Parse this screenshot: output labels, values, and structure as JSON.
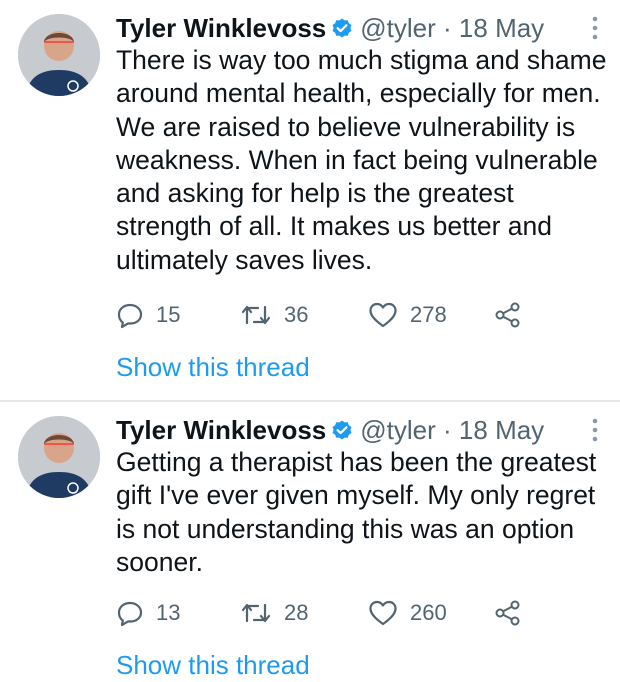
{
  "tweets": [
    {
      "author_name": "Tyler Winklevoss",
      "handle": "@tyler",
      "separator": "·",
      "date": "18 May",
      "text": "There is way too much stigma and shame around mental health, especially for men. We are raised to believe vulnerability is weakness. When in fact being vulnerable and asking for help is the greatest strength of all. It makes us better and ultimately saves lives.",
      "replies": "15",
      "retweets": "36",
      "likes": "278",
      "show_thread": "Show this thread"
    },
    {
      "author_name": "Tyler Winklevoss",
      "handle": "@tyler",
      "separator": "·",
      "date": "18 May",
      "text": "Getting a therapist has been the greatest gift I've ever given myself. My only regret is not understanding this was an option sooner.",
      "replies": "13",
      "retweets": "28",
      "likes": "260",
      "show_thread": "Show this thread"
    }
  ],
  "colors": {
    "link": "#1d9bf0",
    "muted": "#536471",
    "verified": "#1d9bf0",
    "divider": "#e4e7ea"
  },
  "icons": [
    "verified-badge-icon",
    "more-icon",
    "reply-icon",
    "retweet-icon",
    "like-icon",
    "share-icon"
  ]
}
